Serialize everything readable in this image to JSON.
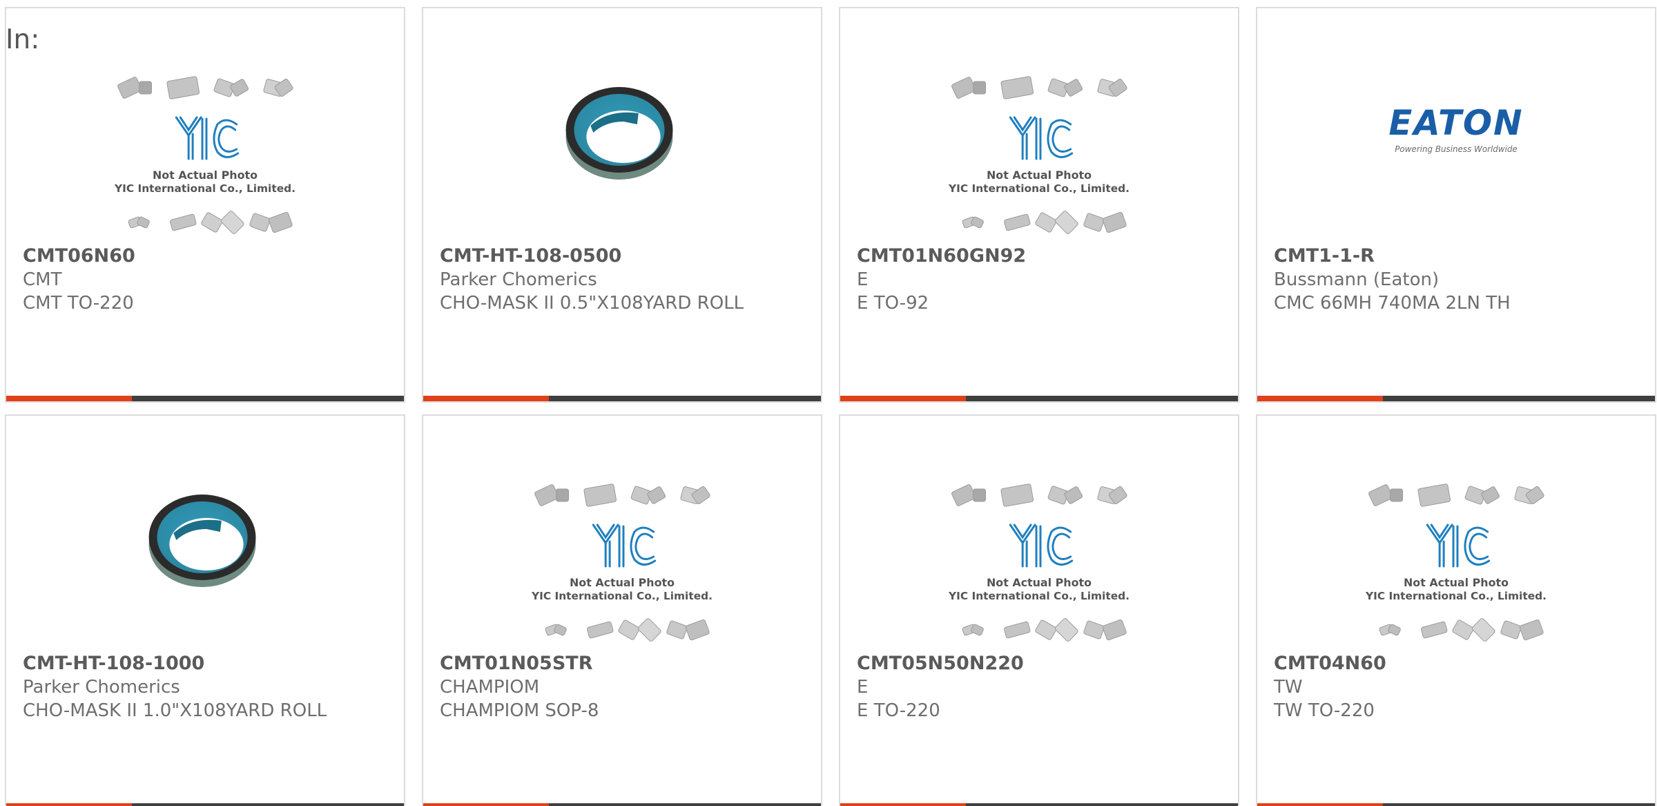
{
  "page": {
    "label": "In:"
  },
  "colors": {
    "accent": "#e0401a",
    "bar": "#3f3f3f",
    "yic_blue": "#1f7fbf",
    "eaton_blue": "#1a5ea8",
    "tape_teal": "#2c86a0"
  },
  "yic_placeholder": {
    "line1": "Not Actual Photo",
    "line2": "YIC International Co., Limited.",
    "logo": "YIC"
  },
  "eaton_logo": {
    "wordmark": "EATON",
    "tagline": "Powering Business Worldwide"
  },
  "products": [
    {
      "part": "CMT06N60",
      "maker": "CMT",
      "desc": "CMT TO-220",
      "image": "yic-placeholder-image"
    },
    {
      "part": "CMT-HT-108-0500",
      "maker": "Parker Chomerics",
      "desc": "CHO-MASK II 0.5\"X108YARD ROLL",
      "image": "tape-roll-image"
    },
    {
      "part": "CMT01N60GN92",
      "maker": "E",
      "desc": "E TO-92",
      "image": "yic-placeholder-image"
    },
    {
      "part": "CMT1-1-R",
      "maker": "Bussmann (Eaton)",
      "desc": "CMC 66MH 740MA 2LN TH",
      "image": "eaton-logo-image"
    },
    {
      "part": "CMT-HT-108-1000",
      "maker": "Parker Chomerics",
      "desc": "CHO-MASK II 1.0\"X108YARD ROLL",
      "image": "tape-roll-image"
    },
    {
      "part": "CMT01N05STR",
      "maker": "CHAMPIOM",
      "desc": "CHAMPIOM SOP-8",
      "image": "yic-placeholder-image"
    },
    {
      "part": "CMT05N50N220",
      "maker": "E",
      "desc": "E TO-220",
      "image": "yic-placeholder-image"
    },
    {
      "part": "CMT04N60",
      "maker": "TW",
      "desc": "TW TO-220",
      "image": "yic-placeholder-image"
    }
  ]
}
